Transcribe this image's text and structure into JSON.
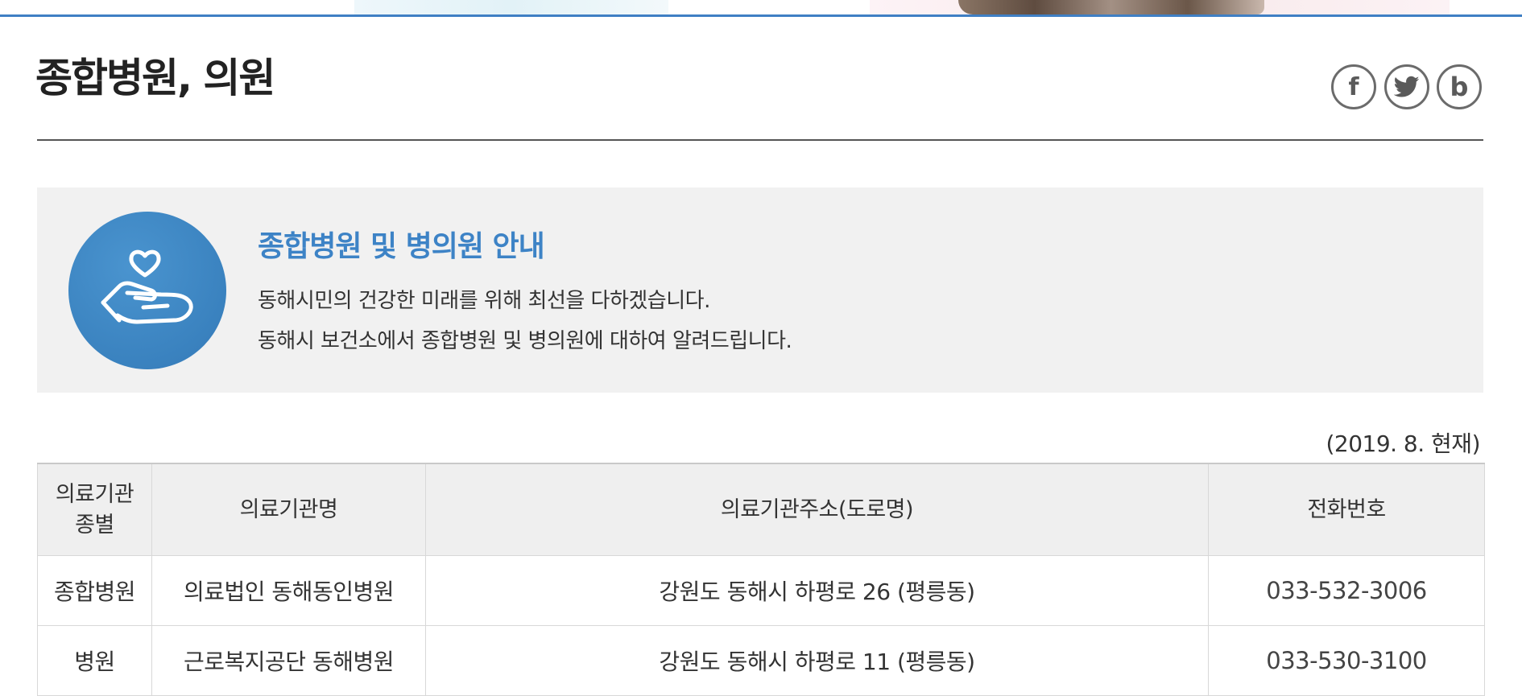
{
  "page": {
    "title": "종합병원, 의원"
  },
  "share": {
    "facebook_glyph": "f",
    "twitter_icon": "twitter-icon",
    "blog_glyph": "b"
  },
  "intro": {
    "heading": "종합병원 및 병의원 안내",
    "line1": "동해시민의 건강한 미래를 위해 최선을 다하겠습니다.",
    "line2": "동해시 보건소에서 종합병원 및 병의원에 대하여 알려드립니다.",
    "icon": "heart-in-hand-icon",
    "icon_color": "#3a82bf",
    "heading_color": "#3d83c6"
  },
  "as_of": "(2019. 8. 현재)",
  "table": {
    "headers": {
      "type_line1": "의료기관",
      "type_line2": "종별",
      "name": "의료기관명",
      "address": "의료기관주소(도로명)",
      "phone": "전화번호"
    },
    "rows": [
      {
        "type": "종합병원",
        "name": "의료법인 동해동인병원",
        "address": "강원도 동해시 하평로 26 (평릉동)",
        "phone": "033-532-3006"
      },
      {
        "type": "병원",
        "name": "근로복지공단 동해병원",
        "address": "강원도 동해시 하평로 11 (평릉동)",
        "phone": "033-530-3100"
      }
    ]
  },
  "colors": {
    "accent_line": "#3f7fc4",
    "box_bg": "#f1f1f1"
  }
}
